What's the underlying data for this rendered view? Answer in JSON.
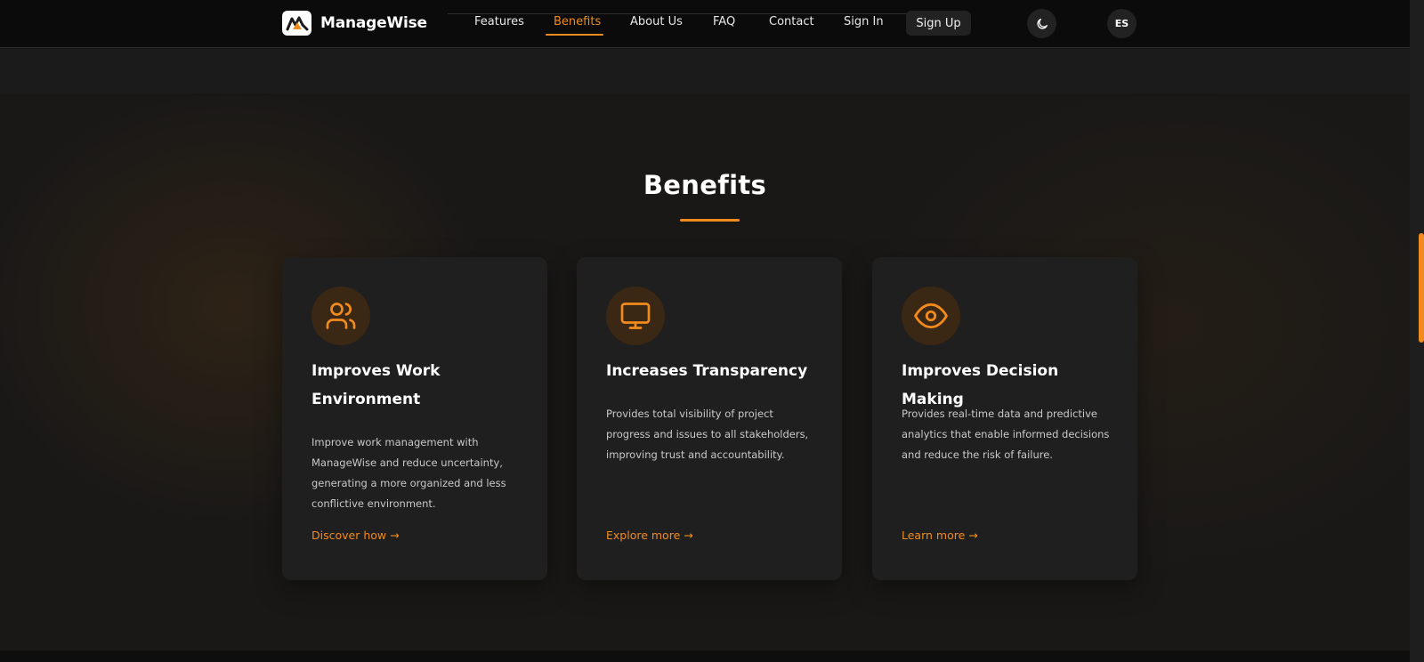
{
  "header": {
    "logo_text": "ManageWise",
    "nav": [
      {
        "label": "Features"
      },
      {
        "label": "Benefits",
        "active": true
      },
      {
        "label": "About Us"
      },
      {
        "label": "FAQ"
      },
      {
        "label": "Contact"
      },
      {
        "label": "Sign In"
      }
    ],
    "signup_label": "Sign Up",
    "theme_toggle_icon": "moon-icon",
    "language_label": "ES"
  },
  "section": {
    "title": "Benefits",
    "cards": [
      {
        "icon": "users-icon",
        "title": "Improves Work Environment",
        "description": "Improve work management with ManageWise and reduce uncertainty, generating a more organized and less conflictive environment.",
        "link": "Discover how →"
      },
      {
        "icon": "monitor-icon",
        "title": "Increases Transparency",
        "description": "Provides total visibility of project progress and issues to all stakeholders, improving trust and accountability.",
        "link": "Explore more →"
      },
      {
        "icon": "eye-icon",
        "title": "Improves Decision Making",
        "description": "Provides real-time data and predictive analytics that enable informed decisions and reduce the risk of failure.",
        "link": "Learn more →"
      }
    ]
  },
  "colors": {
    "accent": "#f28b1d",
    "header_bg": "#0b0b0b",
    "card_bg": "#1f1f1f",
    "page_bg": "#191817"
  }
}
